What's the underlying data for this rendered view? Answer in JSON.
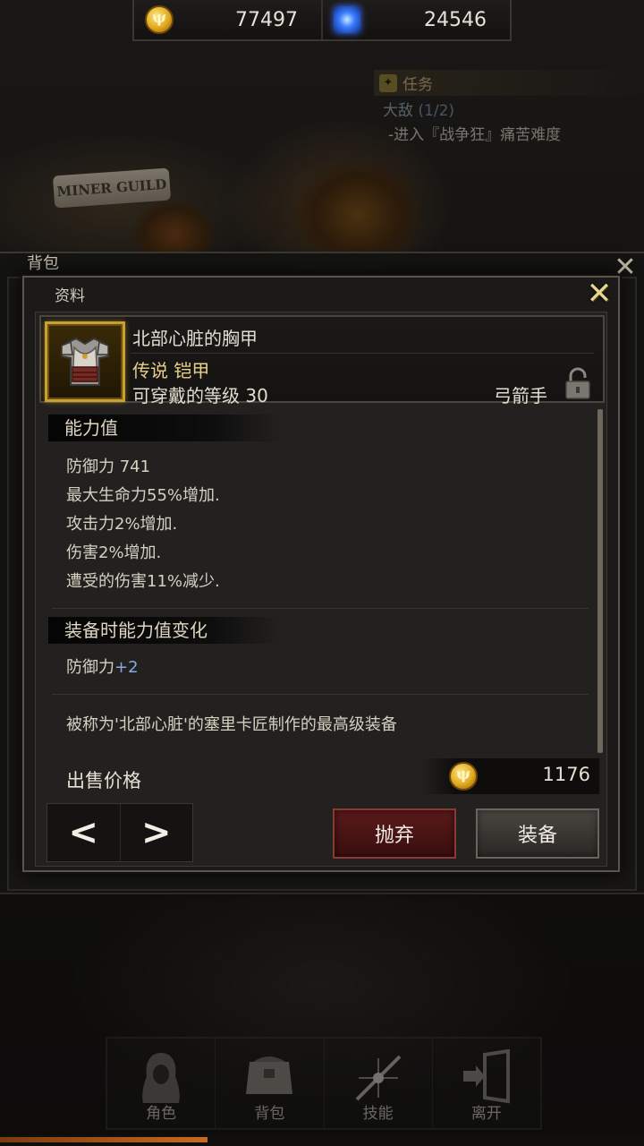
{
  "currency": {
    "gold_icon": "gold-coin-icon",
    "gold": "77497",
    "gem_icon": "blue-gem-icon",
    "gems": "24546"
  },
  "quest": {
    "title": "任务",
    "objective": "大敌",
    "progress": "(1/2)",
    "detail": "-进入『战争狂』痛苦难度"
  },
  "scene": {
    "guild_sign": "MINER GUILD"
  },
  "backpack": {
    "title": "背包"
  },
  "dialog": {
    "title": "资料",
    "item": {
      "name": "北部心脏的胸甲",
      "grade_type": "传说 铠甲",
      "wear_level": "可穿戴的等级 30",
      "class": "弓箭手",
      "icon": "chest-armor-icon",
      "frame_color": "#c8a030"
    },
    "stats_header": "能力值",
    "stats": [
      "防御力 741",
      "最大生命力55%增加.",
      "攻击力2%增加.",
      "伤害2%增加.",
      "遭受的伤害11%减少."
    ],
    "change_header": "装备时能力值变化",
    "change_label": "防御力",
    "change_value": "+2",
    "description": "被称为'北部心脏'的塞里卡匠制作的最高级装备",
    "price_label": "出售价格",
    "price": "1176",
    "prev": "<",
    "next": ">",
    "drop_label": "抛弃",
    "equip_label": "装备"
  },
  "tabs": [
    {
      "label": "角色",
      "icon": "character-icon"
    },
    {
      "label": "背包",
      "icon": "bag-icon"
    },
    {
      "label": "技能",
      "icon": "skill-icon"
    },
    {
      "label": "离开",
      "icon": "exit-icon"
    }
  ],
  "colors": {
    "legendary": "#e8cf8a",
    "stat_positive": "#8aa8e0",
    "drop_button": "#5a1a1a"
  }
}
